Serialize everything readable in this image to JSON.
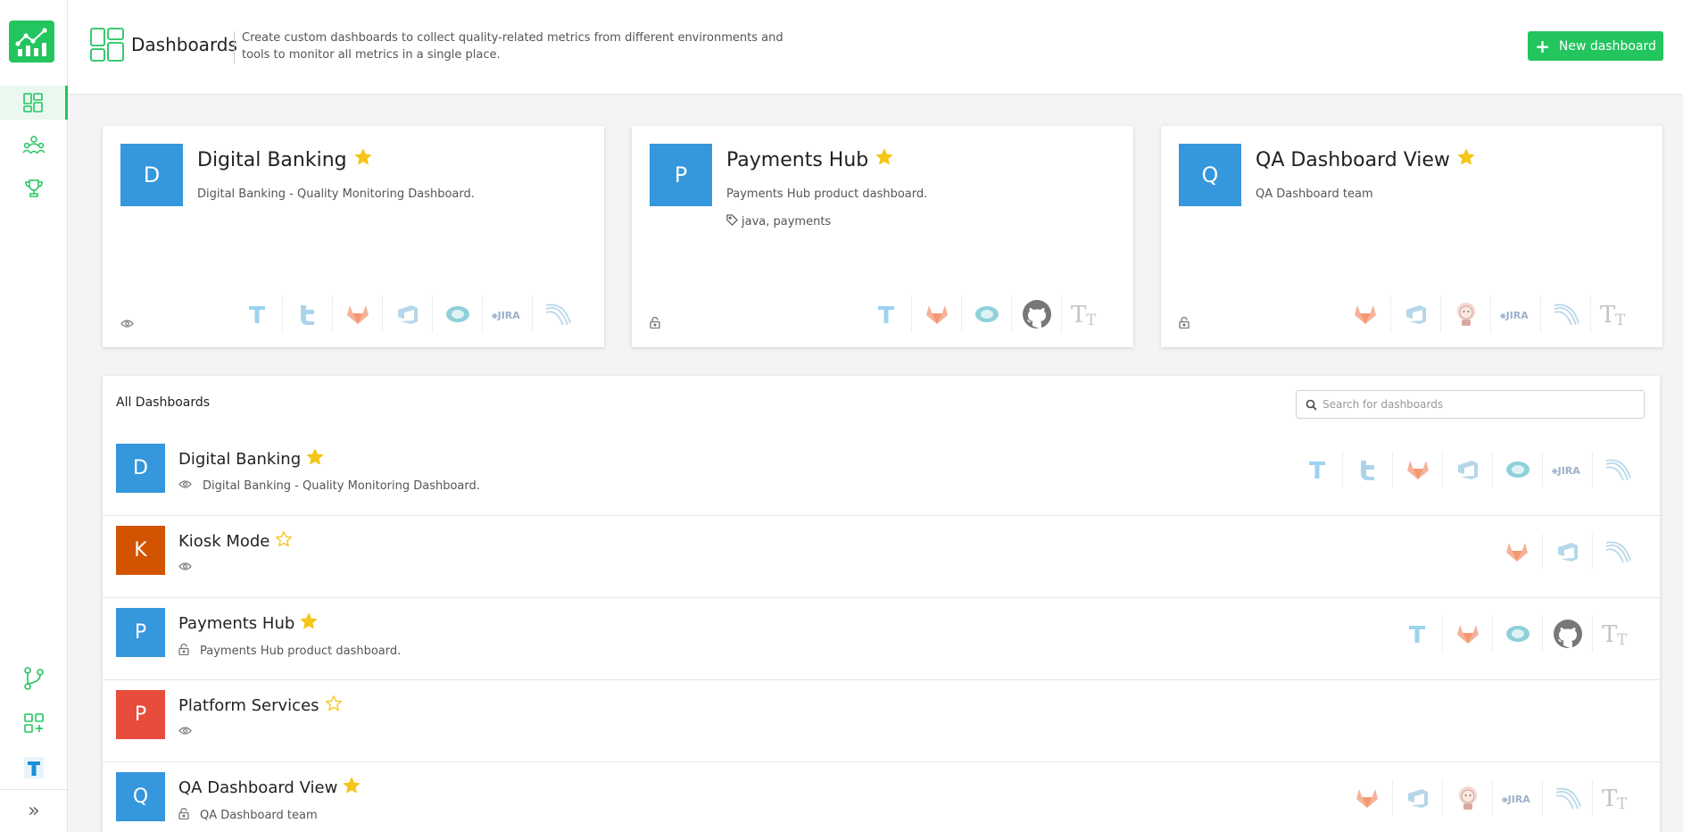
{
  "header": {
    "title": "Dashboards",
    "description": "Create custom dashboards to collect quality-related metrics from different environments and tools to monitor all metrics in a single place.",
    "new_button": "New dashboard"
  },
  "sidebar": {
    "items": [
      "dashboards",
      "teams",
      "achievements"
    ],
    "bottom_items": [
      "source-control",
      "integrations",
      "testiny"
    ]
  },
  "cards": [
    {
      "initial": "D",
      "name": "Digital Banking",
      "favorite": true,
      "description": "Digital Banking - Quality Monitoring Dashboard.",
      "tags": "",
      "visibility": "public",
      "color": "#3597dc",
      "tools": [
        "testiny",
        "testrail",
        "gitlab",
        "azure-devops",
        "elastic",
        "jira",
        "xray"
      ]
    },
    {
      "initial": "P",
      "name": "Payments Hub",
      "favorite": true,
      "description": "Payments Hub product dashboard.",
      "tags": "java, payments",
      "visibility": "private",
      "color": "#3597dc",
      "tools": [
        "testiny",
        "gitlab",
        "elastic",
        "github",
        "typography"
      ]
    },
    {
      "initial": "Q",
      "name": "QA Dashboard View",
      "favorite": true,
      "description": "QA Dashboard team",
      "tags": "",
      "visibility": "private",
      "color": "#3597dc",
      "tools": [
        "gitlab",
        "azure-devops",
        "jenkins",
        "jira",
        "xray",
        "typography"
      ]
    }
  ],
  "list": {
    "title": "All Dashboards",
    "search_placeholder": "Search for dashboards",
    "rows": [
      {
        "initial": "D",
        "name": "Digital Banking",
        "favorite": true,
        "description": "Digital Banking - Quality Monitoring Dashboard.",
        "visibility": "public",
        "color": "#3597dc",
        "tools": [
          "testiny",
          "testrail",
          "gitlab",
          "azure-devops",
          "elastic",
          "jira",
          "xray"
        ]
      },
      {
        "initial": "K",
        "name": "Kiosk Mode",
        "favorite": false,
        "description": "",
        "visibility": "public",
        "color": "#d35400",
        "tools": [
          "gitlab",
          "azure-devops",
          "xray"
        ]
      },
      {
        "initial": "P",
        "name": "Payments Hub",
        "favorite": true,
        "description": "Payments Hub product dashboard.",
        "visibility": "private",
        "color": "#3597dc",
        "tools": [
          "testiny",
          "gitlab",
          "elastic",
          "github",
          "typography"
        ]
      },
      {
        "initial": "P",
        "name": "Platform Services",
        "favorite": false,
        "description": "",
        "visibility": "public",
        "color": "#e74c3c",
        "tools": []
      },
      {
        "initial": "Q",
        "name": "QA Dashboard View",
        "favorite": true,
        "description": "QA Dashboard team",
        "visibility": "private",
        "color": "#3597dc",
        "tools": [
          "gitlab",
          "azure-devops",
          "jenkins",
          "jira",
          "xray",
          "typography"
        ]
      }
    ]
  },
  "colors": {
    "accent": "#22c55e",
    "star": "#f5c518"
  }
}
